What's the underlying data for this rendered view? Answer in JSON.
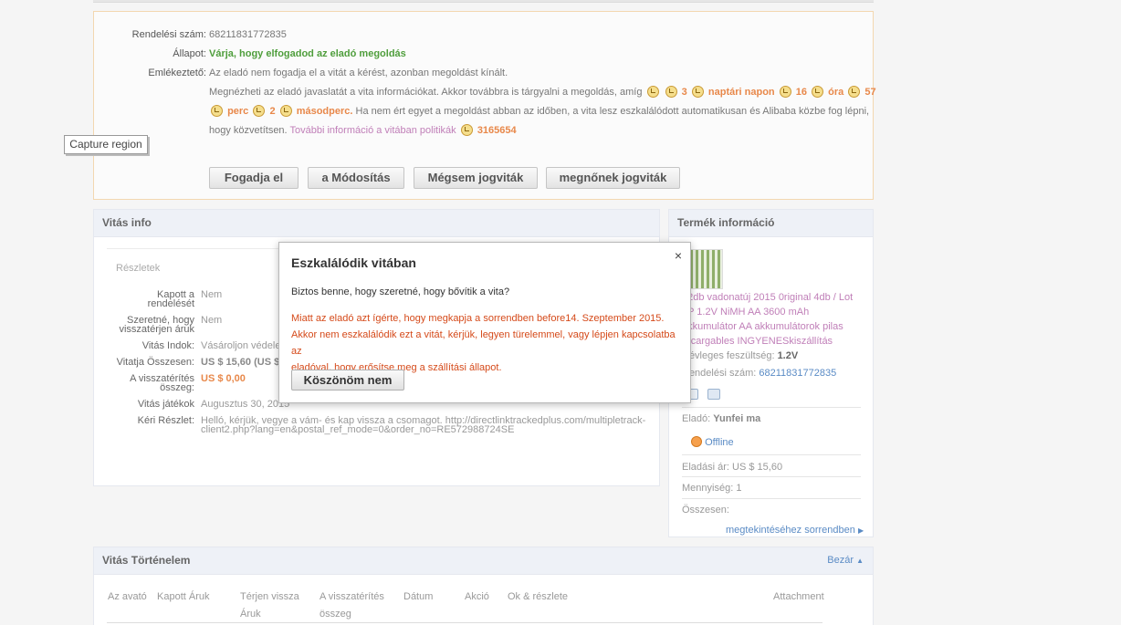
{
  "order": {
    "number_label": "Rendelési szám:",
    "number_value": "68211831772835",
    "status_label": "Állapot:",
    "status_value": "Várja, hogy elfogadod az eladó megoldás",
    "reminder_label": "Emlékeztető:",
    "reminder_line1": "Az eladó nem fogadja el a vitát a kérést, azonban megoldást kínált.",
    "reminder_line2_text": "Megnézheti az eladó javaslatát a vita információkat. Akkor továbbra is tárgyalni a megoldás, amíg",
    "timer": {
      "n1": "3",
      "unit1": "naptári napon",
      "n2": "16",
      "unit2": "óra",
      "n3": "57",
      "unit3": "perc",
      "n4": "2",
      "unit4": "másodperc.",
      "tail": "Ha nem ért egyet a megoldást abban az időben, a vita lesz eszkalálódott automatikusan és Alibaba közbe fog lépni,"
    },
    "reminder_line4_text": "hogy közvetítsen.",
    "policy_link": "További információ a vitában politikák",
    "policy_number": "3165654",
    "buttons": {
      "accept": "Fogadja el",
      "modify": "a Módosítás",
      "cancel": "Mégsem jogviták",
      "increase": "megnőnek jogviták"
    }
  },
  "capture_label": "Capture region",
  "dispute_info": {
    "title": "Vitás info",
    "details_label": "Részletek",
    "rows": [
      {
        "label1": "Kapott a",
        "label2": "rendelését",
        "value": "Nem"
      },
      {
        "label1": "Szeretné, hogy",
        "label2": "visszatérjen áruk",
        "value": "Nem"
      },
      {
        "label": "Vitás Indok:",
        "value": "Vásároljon védeler"
      },
      {
        "label": "Vitatja Összesen:",
        "value": "US $ 15,60 (US $"
      },
      {
        "label1": "A visszatérítés",
        "label2": "összeg:",
        "value": "US $ 0,00"
      },
      {
        "label": "Vitás játékok",
        "value": "Augusztus 30, 2015"
      },
      {
        "label": "Kéri Részlet:",
        "value_line1": "Helló, kérjük, vegye a vám- és kap vissza a csomagot. http://directlinktrackedplus.com/multipletrack-",
        "value_line2": "client2.php?lang=en&postal_ref_mode=0&order_no=RE572988724SE"
      }
    ]
  },
  "product_info": {
    "title": "Termék információ",
    "name_lines": [
      "12db vadonatúj 2015 0riginal 4db / Lot",
      "3P 1.2V NiMH AA 3600 mAh",
      "akkumulátor AA akkumulátorok pilas",
      "recargables INGYENESkiszállítás"
    ],
    "voltage_label": "Névleges feszültség:",
    "voltage_value": "1.2V",
    "order_number_label": "Rendelési szám:",
    "order_number_value": "68211831772835",
    "seller_label": "Eladó:",
    "seller_value": "Yunfei ma",
    "online_status": "Offline",
    "price_label": "Eladási ár:",
    "price_value": "US $ 15,60",
    "qty_label": "Mennyiség:",
    "qty_value": "1",
    "total_label": "Összesen:",
    "view_order_link": "megtekintéséhez sorrendben"
  },
  "history": {
    "title": "Vitás Történelem",
    "close_link": "Bezár",
    "columns": [
      {
        "line1": "Az avató",
        "line2": ""
      },
      {
        "line1": "Kapott Áruk",
        "line2": ""
      },
      {
        "line1": "Térjen vissza",
        "line2": "Áruk"
      },
      {
        "line1": "A visszatérítés",
        "line2": "összeg"
      },
      {
        "line1": "Dátum",
        "line2": ""
      },
      {
        "line1": "Akció",
        "line2": ""
      },
      {
        "line1": "Ok & részlete",
        "line2": ""
      },
      {
        "line1": "Attachment",
        "line2": ""
      }
    ]
  },
  "modal": {
    "title": "Eszkalálódik vitában",
    "close": "×",
    "question": "Biztos benne, hogy szeretné, hogy bővítik a vita?",
    "warning_line1": "Miatt az eladó azt ígérte, hogy megkapja a sorrendben before14. Szeptember 2015.",
    "warning_line2": "Akkor nem eszkalálódik ezt a vitát, kérjük, legyen türelemmel, vagy lépjen kapcsolatba az",
    "warning_line3": "eladóval, hogy erősítse meg a szállítási állapot.",
    "button": "Köszönöm nem"
  },
  "colors": {
    "accent_orange": "#e8884a",
    "status_green": "#4f9e3c",
    "warning_red": "#d54a1a",
    "link_blue": "#5a8bc5",
    "link_purple": "#c07fb8"
  }
}
